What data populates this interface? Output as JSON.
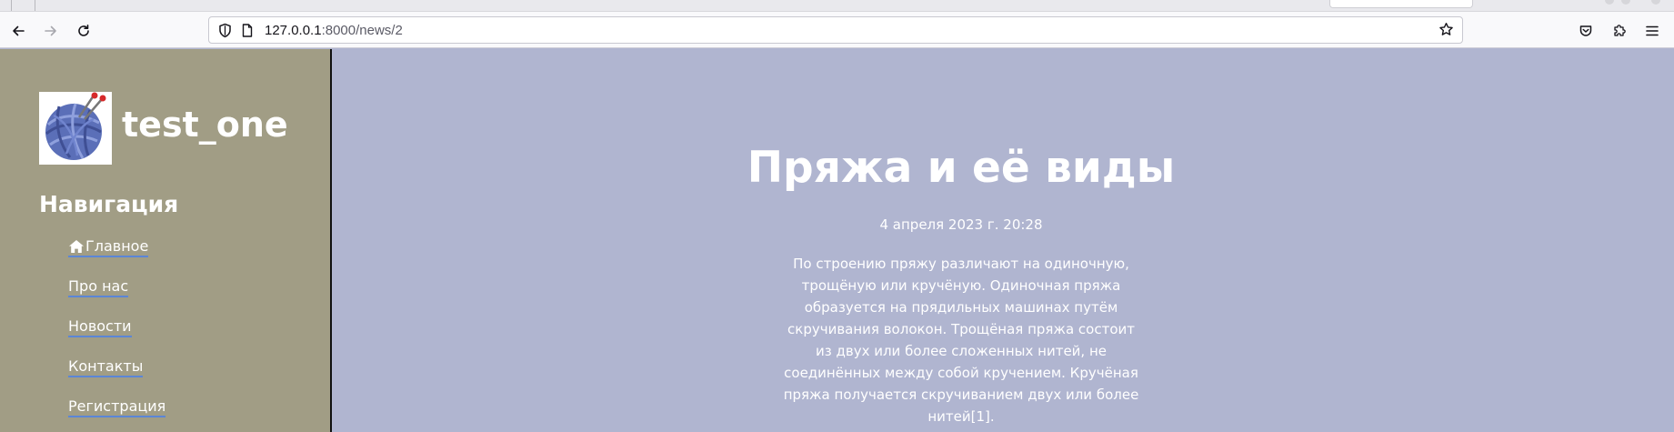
{
  "browser": {
    "url_host": "127.0.0.1",
    "url_rest": ":8000/news/2",
    "icons": {
      "back": "arrow-left-icon",
      "forward": "arrow-right-icon",
      "reload": "reload-icon",
      "shield": "shield-icon",
      "page": "page-icon",
      "bookmark": "star-icon",
      "pocket": "pocket-icon",
      "extensions": "puzzle-icon",
      "menu": "hamburger-icon"
    }
  },
  "site": {
    "name": "test_one",
    "logo": "yarn-ball-logo"
  },
  "nav": {
    "title": "Навигация",
    "items": [
      {
        "label": "Главное",
        "icon": "home-icon"
      },
      {
        "label": "Про нас"
      },
      {
        "label": "Новости"
      },
      {
        "label": "Контакты"
      },
      {
        "label": "Регистрация"
      }
    ]
  },
  "article": {
    "title": "Пряжа и её виды",
    "date": "4 апреля 2023 г. 20:28",
    "body": "По строению пряжу различают на одиночную, трощёную или кручёную. Одиночная пряжа образуется на прядильных машинах путём скручивания волокон. Трощёная пряжа состоит из двух или более сложенных нитей, не соединённых между собой кручением. Кручёная пряжа получается скручиванием двух или более нитей[1]."
  },
  "colors": {
    "sidebar_bg": "#a19d85",
    "main_bg": "#b0b5d0",
    "link_underline": "#5b86d6",
    "text": "#ffffff"
  }
}
